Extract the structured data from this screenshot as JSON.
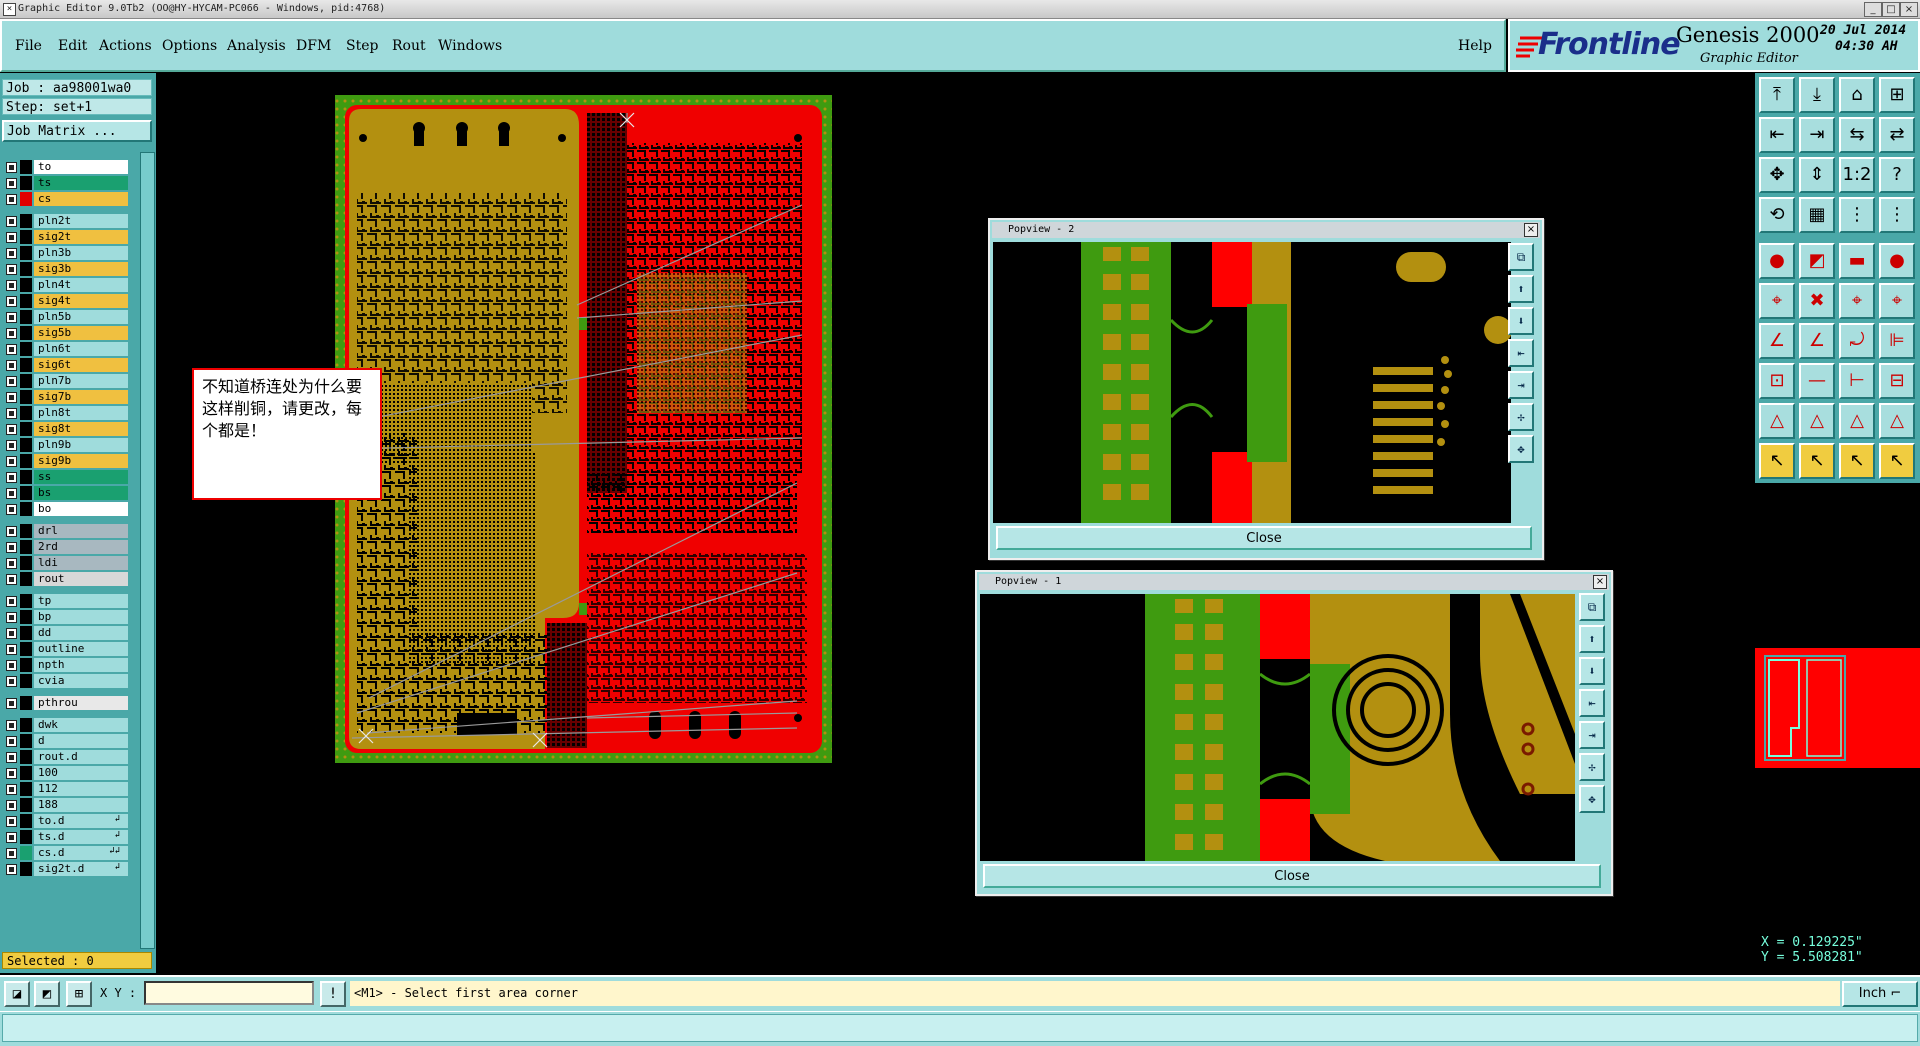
{
  "window": {
    "title": "Graphic Editor 9.0Tb2 (OO@HY-HYCAM-PC066 - Windows, pid:4768)",
    "controls": [
      "_",
      "□",
      "×"
    ]
  },
  "menubar": {
    "items": [
      "File",
      "Edit",
      "Actions",
      "Options",
      "Analysis",
      "DFM",
      "Step",
      "Rout",
      "Windows"
    ],
    "help": "Help"
  },
  "branding": {
    "logo": "Frontline",
    "product": "Genesis 2000",
    "subtitle": "Graphic Editor",
    "date": "20 Jul 2014",
    "time": "04:30 AH"
  },
  "job": {
    "job_line": "Job : aa98001wa0",
    "step_line": "Step: set+1",
    "matrix_button": "Job Matrix ..."
  },
  "layers": [
    {
      "name": "to",
      "color": "#ffffff",
      "swatch": "#000000"
    },
    {
      "name": "ts",
      "color": "#1aa070",
      "swatch": "#000000"
    },
    {
      "name": "cs",
      "color": "#f0c040",
      "swatch": "#e00000"
    },
    {
      "name": "pln2t",
      "color": "#9fdcdc",
      "swatch": "#000000"
    },
    {
      "name": "sig2t",
      "color": "#f0c040",
      "swatch": "#000000"
    },
    {
      "name": "pln3b",
      "color": "#9fdcdc",
      "swatch": "#000000"
    },
    {
      "name": "sig3b",
      "color": "#f0c040",
      "swatch": "#000000"
    },
    {
      "name": "pln4t",
      "color": "#9fdcdc",
      "swatch": "#000000"
    },
    {
      "name": "sig4t",
      "color": "#f0c040",
      "swatch": "#000000"
    },
    {
      "name": "pln5b",
      "color": "#9fdcdc",
      "swatch": "#000000"
    },
    {
      "name": "sig5b",
      "color": "#f0c040",
      "swatch": "#000000"
    },
    {
      "name": "pln6t",
      "color": "#9fdcdc",
      "swatch": "#000000"
    },
    {
      "name": "sig6t",
      "color": "#f0c040",
      "swatch": "#000000"
    },
    {
      "name": "pln7b",
      "color": "#9fdcdc",
      "swatch": "#000000"
    },
    {
      "name": "sig7b",
      "color": "#f0c040",
      "swatch": "#000000"
    },
    {
      "name": "pln8t",
      "color": "#9fdcdc",
      "swatch": "#000000"
    },
    {
      "name": "sig8t",
      "color": "#f0c040",
      "swatch": "#000000"
    },
    {
      "name": "pln9b",
      "color": "#9fdcdc",
      "swatch": "#000000"
    },
    {
      "name": "sig9b",
      "color": "#f0c040",
      "swatch": "#000000"
    },
    {
      "name": "ss",
      "color": "#1aa070",
      "swatch": "#000000"
    },
    {
      "name": "bs",
      "color": "#1aa070",
      "swatch": "#000000"
    },
    {
      "name": "bo",
      "color": "#ffffff",
      "swatch": "#000000"
    },
    {
      "name": "drl",
      "color": "#a8b8c0",
      "swatch": "#000000"
    },
    {
      "name": "2rd",
      "color": "#a8b8c0",
      "swatch": "#000000"
    },
    {
      "name": "ldi",
      "color": "#a8b8c0",
      "swatch": "#000000"
    },
    {
      "name": "rout",
      "color": "#d8d8d8",
      "swatch": "#000000"
    },
    {
      "name": "tp",
      "color": "#9fdcdc",
      "swatch": "#000000"
    },
    {
      "name": "bp",
      "color": "#9fdcdc",
      "swatch": "#000000"
    },
    {
      "name": "dd",
      "color": "#9fdcdc",
      "swatch": "#000000"
    },
    {
      "name": "outline",
      "color": "#9fdcdc",
      "swatch": "#000000"
    },
    {
      "name": "npth",
      "color": "#9fdcdc",
      "swatch": "#000000"
    },
    {
      "name": "cvia",
      "color": "#9fdcdc",
      "swatch": "#000000"
    },
    {
      "name": "pthrou",
      "color": "#e8e8e8",
      "swatch": "#000000"
    },
    {
      "name": "dwk",
      "color": "#9fdcdc",
      "swatch": "#000000"
    },
    {
      "name": "d",
      "color": "#9fdcdc",
      "swatch": "#000000"
    },
    {
      "name": "rout.d",
      "color": "#9fdcdc",
      "swatch": "#000000"
    },
    {
      "name": "100",
      "color": "#9fdcdc",
      "swatch": "#000000"
    },
    {
      "name": "112",
      "color": "#9fdcdc",
      "swatch": "#000000"
    },
    {
      "name": "188",
      "color": "#9fdcdc",
      "swatch": "#000000"
    },
    {
      "name": "to.d",
      "color": "#9fdcdc",
      "swatch": "#000000",
      "mark": "↲"
    },
    {
      "name": "ts.d",
      "color": "#9fdcdc",
      "swatch": "#000000",
      "mark": "↲"
    },
    {
      "name": "cs.d",
      "color": "#9fdcdc",
      "swatch": "#1aa070",
      "mark": "↲↲"
    },
    {
      "name": "sig2t.d",
      "color": "#9fdcdc",
      "swatch": "#000000",
      "mark": "↲"
    }
  ],
  "selected": "Selected : 0",
  "note": {
    "text": "不知道桥连处为什么要这样削铜，请更改，每个都是！"
  },
  "popups": [
    {
      "title": "Popview - 2",
      "close_label": "Close"
    },
    {
      "title": "Popview - 1",
      "close_label": "Close"
    }
  ],
  "popup_tools": [
    "⧉",
    "⬆",
    "⬇",
    "⇤",
    "⇥",
    "✢",
    "✥"
  ],
  "right_tools": [
    "⤒",
    "⤓",
    "⌂",
    "⊞",
    "⇤",
    "⇥",
    "⇆",
    "⇄",
    "✥",
    "⇕",
    "1:2",
    "?",
    "⟲",
    "▦",
    "⋮",
    "⋮",
    "●",
    "◩",
    "▬",
    "●",
    "⌖",
    "✖",
    "⌖",
    "⌖",
    "∠",
    "∠",
    "⤾",
    "⊫",
    "⊡",
    "—",
    "⊢",
    "⊟",
    "△",
    "△",
    "△",
    "△",
    "↖",
    "↖",
    "↖",
    "↖"
  ],
  "coords": {
    "x": "X = 0.129225\"",
    "y": "Y = 5.508281\""
  },
  "statusbar": {
    "xy_label": "X Y :",
    "xy_value": "",
    "message": "<M1> - Select first area corner",
    "units": "Inch ⌐"
  },
  "colors": {
    "panel_bg": "#9fdcdc",
    "pcb_yellow": "#b39010",
    "pcb_red": "#f00000",
    "pcb_green": "#3f9b10",
    "accent": "#4aa8a8"
  }
}
